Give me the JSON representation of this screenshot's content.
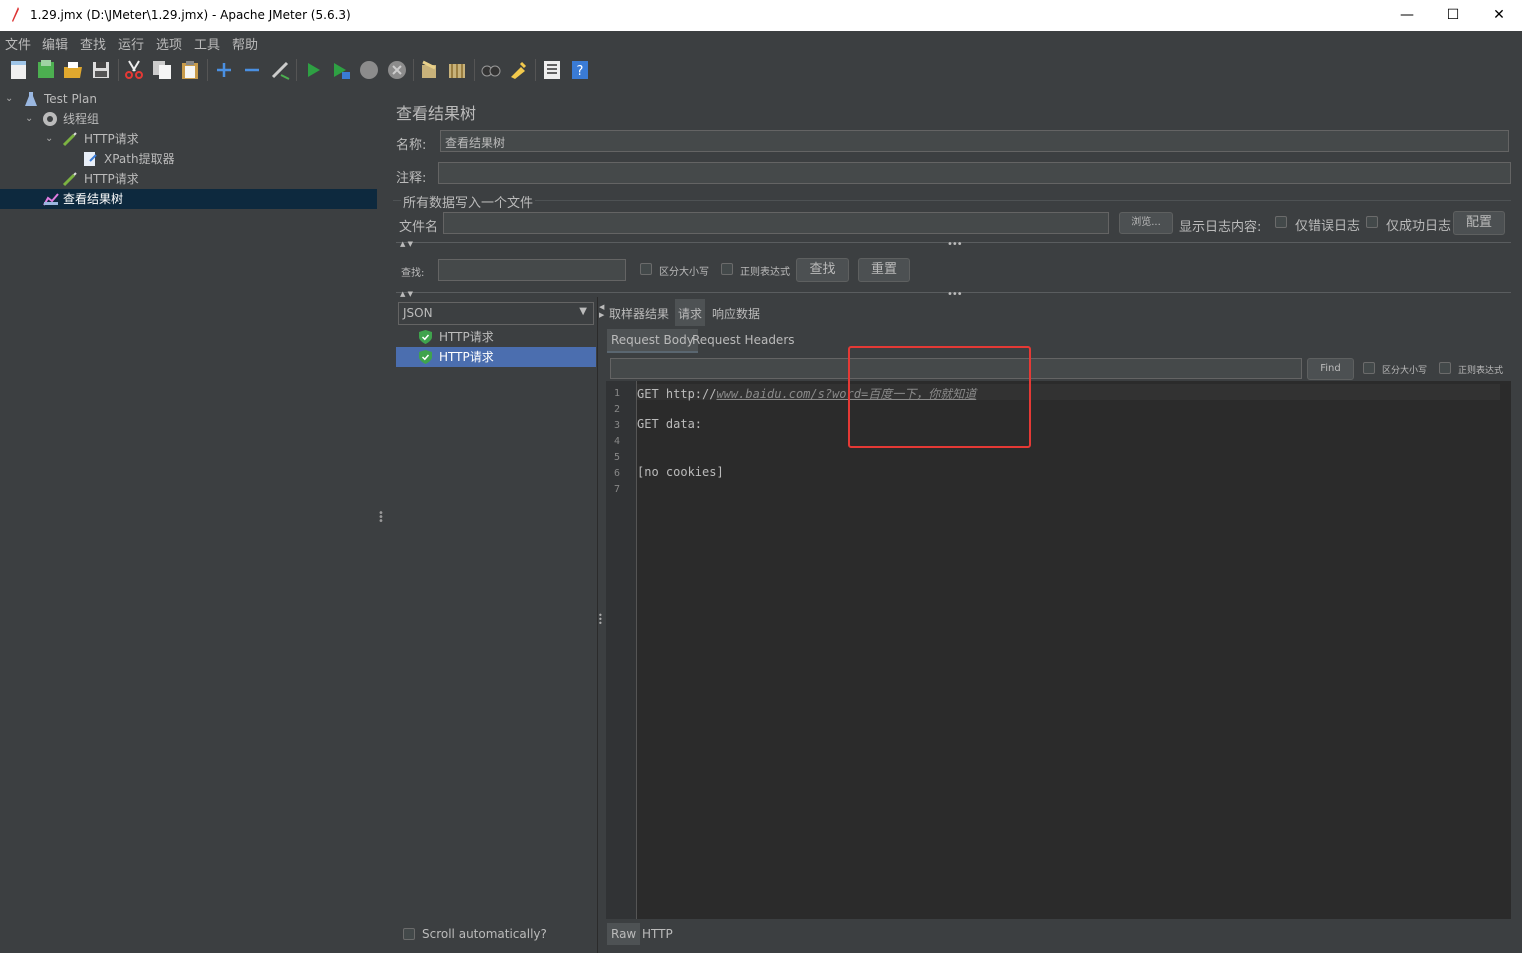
{
  "window": {
    "title": "1.29.jmx (D:\\JMeter\\1.29.jmx) - Apache JMeter (5.6.3)",
    "minimize": "—",
    "maximize": "☐",
    "close": "✕"
  },
  "menu": [
    "文件",
    "编辑",
    "查找",
    "运行",
    "选项",
    "工具",
    "帮助"
  ],
  "toolbar_icons": [
    "new-icon",
    "templates-icon",
    "open-icon",
    "save-icon",
    "cut-icon",
    "copy-icon",
    "paste-icon",
    "expand-icon",
    "collapse-icon",
    "toggle-icon",
    "start-icon",
    "start-no-pause-icon",
    "stop-icon",
    "shutdown-icon",
    "clear-icon",
    "clear-all-icon",
    "search-icon",
    "reset-search-icon",
    "function-helper-icon",
    "help-icon"
  ],
  "tree": {
    "items": [
      {
        "label": "Test Plan"
      },
      {
        "label": "线程组"
      },
      {
        "label": "HTTP请求"
      },
      {
        "label": "XPath提取器"
      },
      {
        "label": "HTTP请求"
      },
      {
        "label": "查看结果树"
      }
    ]
  },
  "panel": {
    "heading": "查看结果树",
    "name_label": "名称:",
    "name_value": "查看结果树",
    "comment_label": "注释:",
    "comment_value": "",
    "file_section": "所有数据写入一个文件",
    "filename_label": "文件名",
    "filename_value": "",
    "browse_button": "浏览...",
    "log_label": "显示日志内容:",
    "errors_only": "仅错误日志",
    "success_only": "仅成功日志",
    "config_button": "配置",
    "search_label": "查找:",
    "search_value": "",
    "case_sensitive": "区分大小写",
    "regex": "正则表达式",
    "find_button": "查找",
    "reset_button": "重置",
    "renderer_select": "JSON",
    "results": [
      {
        "label": "HTTP请求",
        "status": "success"
      },
      {
        "label": "HTTP请求",
        "status": "success"
      }
    ],
    "scroll_auto": "Scroll automatically?"
  },
  "detail": {
    "tabs": [
      "取样器结果",
      "请求",
      "响应数据"
    ],
    "active_tab": "请求",
    "subtabs": [
      "Request Body",
      "Request Headers"
    ],
    "active_subtab": "Request Body",
    "find_value": "",
    "find_button": "Find",
    "case_sensitive": "区分大小写",
    "regex": "正则表达式",
    "lines": [
      "1",
      "2",
      "3",
      "4",
      "5",
      "6",
      "7"
    ],
    "code": {
      "l1_prefix": "GET http://",
      "l1_url": "www.baidu.com/s?word=百度一下，你就知道",
      "l3": "GET data:",
      "l6": "[no cookies]"
    },
    "bottom_tabs": [
      "Raw",
      "HTTP"
    ],
    "active_bottom_tab": "Raw"
  },
  "colors": {
    "highlight_box": "#e53935",
    "selection": "#4b6eaf",
    "success_icon": "#3fa34d"
  }
}
